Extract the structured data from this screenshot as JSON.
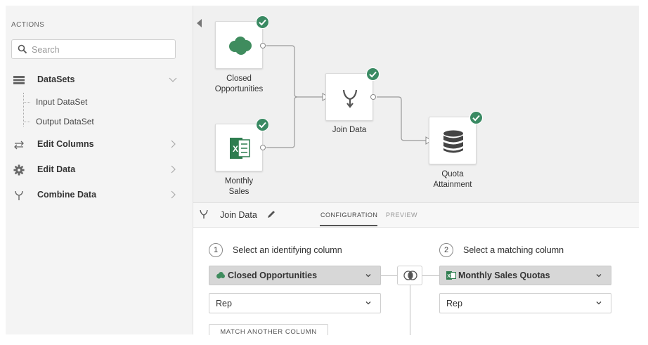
{
  "sidebar": {
    "title": "ACTIONS",
    "search_placeholder": "Search",
    "actions": [
      {
        "label": "DataSets",
        "icon": "datasets-icon",
        "expanded": true
      },
      {
        "label": "Edit Columns",
        "icon": "edit-columns-icon"
      },
      {
        "label": "Edit Data",
        "icon": "gear-icon"
      },
      {
        "label": "Combine Data",
        "icon": "combine-icon"
      }
    ],
    "datasets_children": [
      "Input DataSet",
      "Output DataSet"
    ]
  },
  "canvas": {
    "nodes": [
      {
        "id": "closed-opportunities",
        "label_lines": [
          "Closed",
          "Opportunities"
        ],
        "icon": "salesforce-cloud-icon",
        "status": "complete"
      },
      {
        "id": "monthly-sales",
        "label_lines": [
          "Monthly",
          "Sales"
        ],
        "icon": "excel-icon",
        "status": "complete"
      },
      {
        "id": "join-data",
        "label_lines": [
          "Join Data"
        ],
        "icon": "join-icon",
        "status": "complete"
      },
      {
        "id": "quota-attainment",
        "label_lines": [
          "Quota",
          "Attainment"
        ],
        "icon": "database-icon",
        "status": "complete"
      }
    ]
  },
  "panel": {
    "title": "Join Data",
    "tabs": [
      {
        "label": "CONFIGURATION",
        "active": true
      },
      {
        "label": "PREVIEW",
        "active": false
      }
    ],
    "step1": {
      "number": "1",
      "label": "Select an identifying column",
      "source": "Closed Opportunities",
      "column": "Rep"
    },
    "step2": {
      "number": "2",
      "label": "Select a matching column",
      "source": "Monthly Sales Quotas",
      "column": "Rep"
    },
    "match_another_label": "MATCH ANOTHER COLUMN"
  },
  "colors": {
    "check_green": "#3a8a63",
    "salesforce_green": "#3f8c5e",
    "excel_green": "#2e7d4f",
    "canvas_bg": "#f0f0f0"
  }
}
